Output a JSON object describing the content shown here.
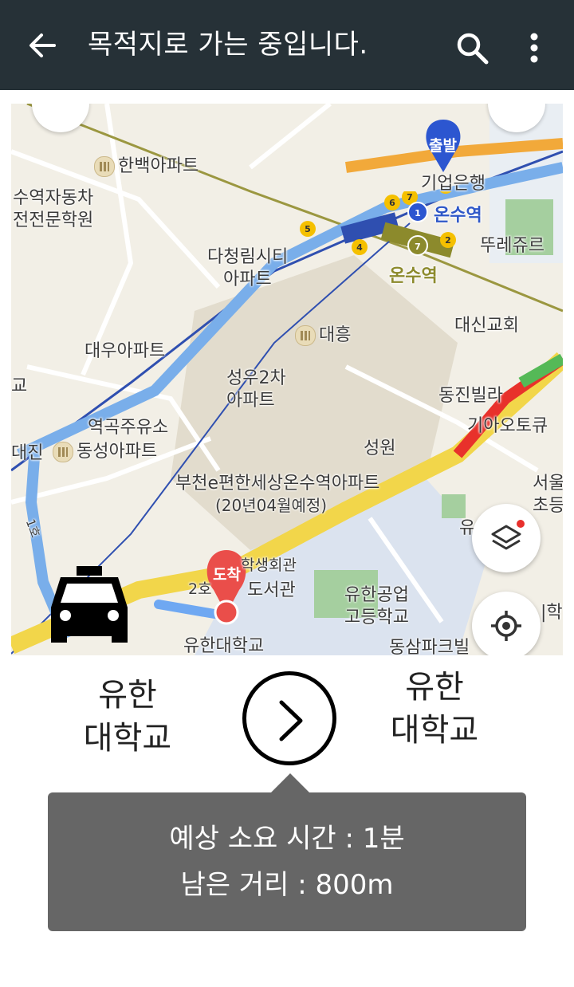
{
  "appbar": {
    "title": "목적지로 가는 중입니다.",
    "back_icon": "arrow-left-icon",
    "search_icon": "search-icon",
    "more_icon": "more-vert-icon",
    "background": "#263137"
  },
  "map": {
    "labels": {
      "hanbaek": "한백아파트",
      "suyeok1": "수역자동차",
      "suyeok2": "전전문학원",
      "dacheong1": "다청림시티",
      "dacheong2": "아파트",
      "onsu_blue": "온수역",
      "onsu_olive": "온수역",
      "ddurejureu": "뚜레쥬르",
      "bank": "기업은행",
      "daewoo": "대우아파트",
      "daeheung": "대흥",
      "daeshin": "대신교회",
      "seongwoo1": "성우2차",
      "seongwoo2": "아파트",
      "dongjin": "동진빌라",
      "station_oil": "역곡주유소",
      "dongseong": "동성아파트",
      "kia": "기아오토큐",
      "seongwon": "성원",
      "bucheon1": "부천e편한세상온수역아파트",
      "bucheon2": "(20년04월예정)",
      "seoul1": "서울",
      "seoul2": "초등",
      "yu": "유",
      "student_hall": "학생회관",
      "library": "도서관",
      "yuhan_tech1": "유한공업",
      "yuhan_tech2": "고등학교",
      "yuhan_univ": "유한대학교",
      "dongsam": "동삼파크빌",
      "gyo_left": "교",
      "jin_left": "대진",
      "line2": "2호",
      "hak": "|학",
      "line1": "1호"
    },
    "markers": {
      "start": "출발",
      "arrival": "도착"
    },
    "line_numbers": [
      "8",
      "6",
      "7",
      "5",
      "1",
      "2",
      "4",
      "7"
    ],
    "layers_icon": "layers-icon",
    "locate_icon": "my-location-icon",
    "taxi_icon": "taxi-icon"
  },
  "route": {
    "from": "유한\n대학교",
    "to": "유한\n대학교",
    "go_icon": "chevron-right-icon"
  },
  "eta": {
    "time_text": "예상 소요 시간 : 1분",
    "distance_text": "남은 거리 :  800m"
  }
}
